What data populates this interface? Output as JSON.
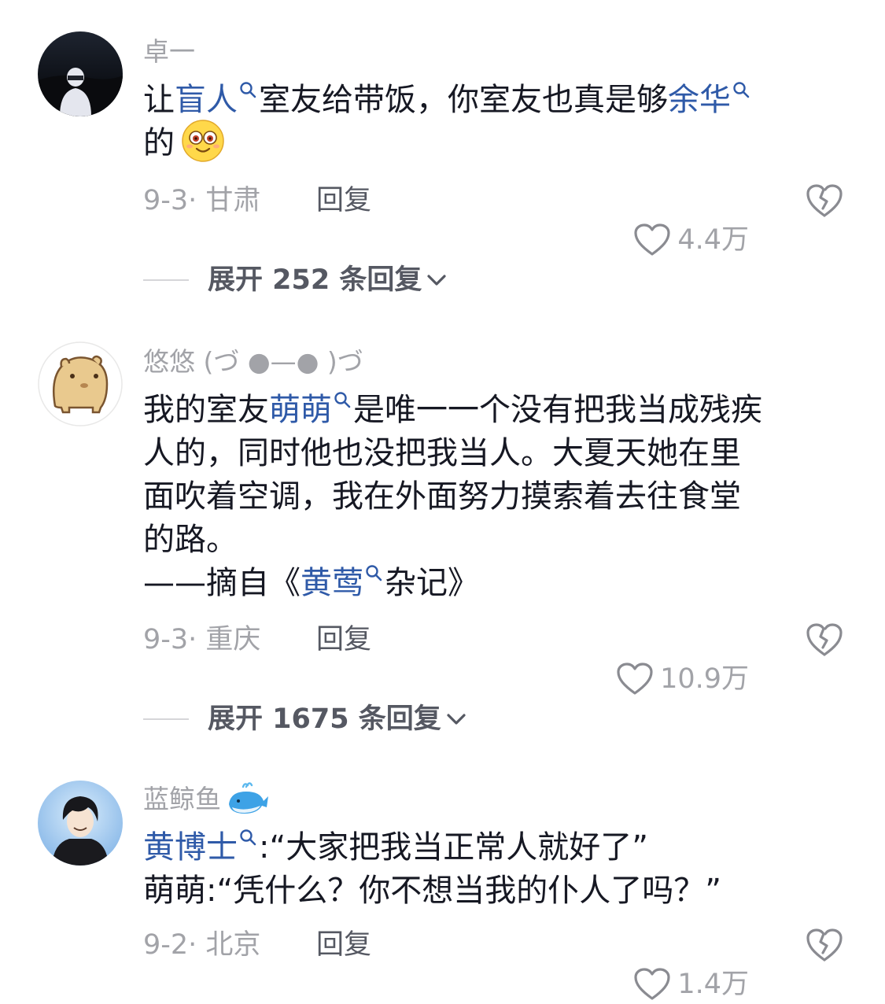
{
  "comments": [
    {
      "username": "卓一",
      "lines": [
        [
          {
            "t": "让"
          },
          {
            "t": "盲人",
            "tag": true
          },
          {
            "t": "室友给带饭，你室友也真是够"
          },
          {
            "t": "余华",
            "tag": true
          }
        ],
        [
          {
            "t": "的"
          }
        ]
      ],
      "emoji": "smile-emoji",
      "date_location": "9-3· 甘肃",
      "reply_label": "回复",
      "likes": "4.4万",
      "expand_label": "展开 252 条回复"
    },
    {
      "username": "悠悠 (づ ●—● )づ",
      "lines": [
        [
          {
            "t": "我的室友"
          },
          {
            "t": "萌萌",
            "tag": true
          },
          {
            "t": "是唯一一个没有把我当成残疾"
          }
        ],
        [
          {
            "t": "人的，同时他也没把我当人。大夏天她在里"
          }
        ],
        [
          {
            "t": "面吹着空调，我在外面努力摸索着去往食堂"
          }
        ],
        [
          {
            "t": "的路。"
          }
        ],
        [
          {
            "t": "——摘自《"
          },
          {
            "t": "黄莺",
            "tag": true
          },
          {
            "t": "杂记》"
          }
        ]
      ],
      "date_location": "9-3· 重庆",
      "reply_label": "回复",
      "likes": "10.9万",
      "expand_label": "展开 1675 条回复"
    },
    {
      "username": "蓝鲸鱼",
      "username_icon": "whale-icon",
      "lines": [
        [
          {
            "t": "黄博士",
            "tag": true
          },
          {
            "t": ":“大家把我当正常人就好了”"
          }
        ],
        [
          {
            "t": "萌萌:“凭什么？你不想当我的仆人了吗？”"
          }
        ]
      ],
      "date_location": "9-2· 北京",
      "reply_label": "回复",
      "likes": "1.4万"
    }
  ],
  "colors": {
    "text": "#161823",
    "muted": "#a2a3a8",
    "tag": "#2f5aa8",
    "reply": "#555862"
  }
}
